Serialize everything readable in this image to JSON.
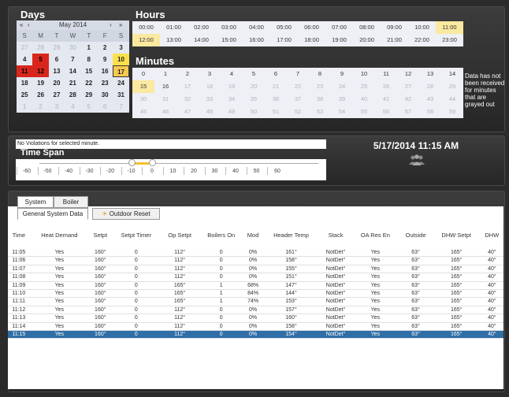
{
  "calendar": {
    "title": "Days",
    "month_label": "May 2014",
    "nav": {
      "first": "«",
      "prev": "‹",
      "next": "›",
      "last": "»"
    },
    "weekdays": [
      "S",
      "M",
      "T",
      "W",
      "T",
      "F",
      "S"
    ],
    "weeks": [
      [
        "27",
        "28",
        "29",
        "30",
        "1",
        "2",
        "3"
      ],
      [
        "4",
        "5",
        "6",
        "7",
        "8",
        "9",
        "10"
      ],
      [
        "11",
        "12",
        "13",
        "14",
        "15",
        "16",
        "17"
      ],
      [
        "18",
        "19",
        "20",
        "21",
        "22",
        "23",
        "24"
      ],
      [
        "25",
        "26",
        "27",
        "28",
        "29",
        "30",
        "31"
      ],
      [
        "1",
        "2",
        "3",
        "4",
        "5",
        "6",
        "7"
      ]
    ],
    "selected_day": "17"
  },
  "hours": {
    "title": "Hours",
    "row1": [
      "00:00",
      "01:00",
      "02:00",
      "03:00",
      "04:00",
      "05:00",
      "06:00",
      "07:00",
      "08:00",
      "09:00",
      "10:00",
      "11:00"
    ],
    "row2": [
      "12:00",
      "13:00",
      "14:00",
      "15:00",
      "16:00",
      "17:00",
      "18:00",
      "19:00",
      "20:00",
      "21:00",
      "22:00",
      "23:00"
    ],
    "selected": "11:00"
  },
  "minutes": {
    "title": "Minutes",
    "rows": [
      [
        "0",
        "1",
        "2",
        "3",
        "4",
        "5",
        "6",
        "7",
        "8",
        "9",
        "10",
        "11",
        "12",
        "13",
        "14"
      ],
      [
        "15",
        "16",
        "17",
        "18",
        "19",
        "20",
        "21",
        "22",
        "23",
        "24",
        "25",
        "26",
        "27",
        "28",
        "29"
      ],
      [
        "30",
        "31",
        "32",
        "33",
        "34",
        "35",
        "36",
        "37",
        "38",
        "39",
        "40",
        "41",
        "42",
        "43",
        "44"
      ],
      [
        "45",
        "46",
        "47",
        "48",
        "49",
        "50",
        "51",
        "52",
        "53",
        "54",
        "55",
        "56",
        "57",
        "58",
        "59"
      ]
    ],
    "selected": "15",
    "note": "Data has not been received for minutes that are grayed out"
  },
  "violations_text": "No Violations for selected minute.",
  "time_span": {
    "title": "Time Span",
    "ticks": [
      "-60",
      "-50",
      "-40",
      "-30",
      "-20",
      "-10",
      "0",
      "10",
      "20",
      "30",
      "40",
      "50",
      "60"
    ],
    "range_start": -10,
    "range_end": 0
  },
  "datetime": "5/17/2014 11:15 AM",
  "tabs": {
    "top": [
      "System",
      "Boiler"
    ],
    "sub": [
      "General System Data",
      "Outdoor Reset"
    ]
  },
  "table": {
    "columns": [
      "Time",
      "Heat Demand",
      "Setpt",
      "Setpt Timer",
      "Op Setpt",
      "Boilers On",
      "Mod",
      "Header Temp",
      "Stack",
      "OA Res En",
      "Outside",
      "DHW Setpt",
      "DHW"
    ],
    "rows": [
      [
        "11:05",
        "Yes",
        "160°",
        "0",
        "112°",
        "0",
        "0%",
        "161°",
        "NotDet°",
        "Yes",
        "63°",
        "165°",
        "40°"
      ],
      [
        "11:06",
        "Yes",
        "160°",
        "0",
        "112°",
        "0",
        "0%",
        "158°",
        "NotDet°",
        "Yes",
        "63°",
        "165°",
        "40°"
      ],
      [
        "11:07",
        "Yes",
        "160°",
        "0",
        "112°",
        "0",
        "0%",
        "155°",
        "NotDet°",
        "Yes",
        "63°",
        "165°",
        "40°"
      ],
      [
        "11:08",
        "Yes",
        "160°",
        "0",
        "112°",
        "0",
        "0%",
        "151°",
        "NotDet°",
        "Yes",
        "63°",
        "165°",
        "40°"
      ],
      [
        "11:09",
        "Yes",
        "160°",
        "0",
        "165°",
        "1",
        "68%",
        "147°",
        "NotDet°",
        "Yes",
        "63°",
        "165°",
        "40°"
      ],
      [
        "11:10",
        "Yes",
        "160°",
        "0",
        "165°",
        "1",
        "84%",
        "144°",
        "NotDet°",
        "Yes",
        "63°",
        "165°",
        "40°"
      ],
      [
        "11:11",
        "Yes",
        "160°",
        "0",
        "165°",
        "1",
        "74%",
        "153°",
        "NotDet°",
        "Yes",
        "63°",
        "165°",
        "40°"
      ],
      [
        "11:12",
        "Yes",
        "160°",
        "0",
        "112°",
        "0",
        "0%",
        "157°",
        "NotDet°",
        "Yes",
        "63°",
        "165°",
        "40°"
      ],
      [
        "11:13",
        "Yes",
        "160°",
        "0",
        "112°",
        "0",
        "0%",
        "160°",
        "NotDet°",
        "Yes",
        "63°",
        "165°",
        "40°"
      ],
      [
        "11:14",
        "Yes",
        "160°",
        "0",
        "112°",
        "0",
        "0%",
        "158°",
        "NotDet°",
        "Yes",
        "63°",
        "165°",
        "40°"
      ],
      [
        "11:15",
        "Yes",
        "160°",
        "0",
        "112°",
        "0",
        "0%",
        "154°",
        "NotDet°",
        "Yes",
        "63°",
        "165°",
        "40°"
      ]
    ],
    "selected_row": 10
  }
}
